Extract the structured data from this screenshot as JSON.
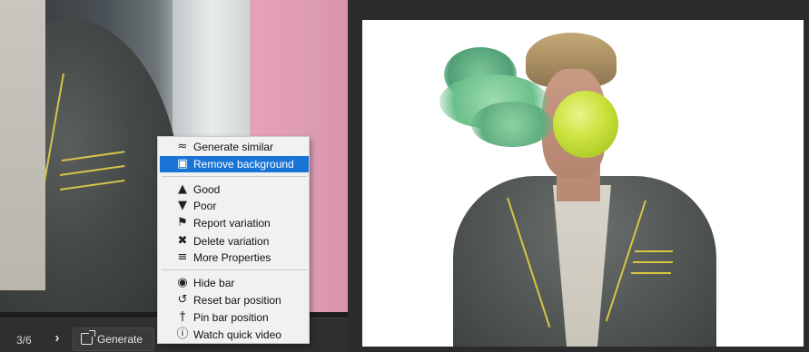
{
  "left_panel": {
    "counter": "3/6",
    "next_icon": "chevron-right-icon",
    "generate_label": "Generate",
    "generate_icon": "open-external-icon"
  },
  "context_menu": {
    "items": [
      {
        "label": "Generate similar",
        "icon": "approx-icon",
        "active": false
      },
      {
        "label": "Remove background",
        "icon": "image-icon",
        "active": true
      },
      {
        "label": "Good",
        "icon": "thumbs-up-icon",
        "active": false
      },
      {
        "label": "Poor",
        "icon": "thumbs-down-icon",
        "active": false
      },
      {
        "label": "Report variation",
        "icon": "flag-icon",
        "active": false
      },
      {
        "label": "Delete variation",
        "icon": "trash-icon",
        "active": false
      },
      {
        "label": "More Properties",
        "icon": "sliders-icon",
        "active": false
      },
      {
        "label": "Hide bar",
        "icon": "eye-off-icon",
        "active": false
      },
      {
        "label": "Reset bar position",
        "icon": "undo-icon",
        "active": false
      },
      {
        "label": "Pin bar position",
        "icon": "pin-icon",
        "active": false
      },
      {
        "label": "Watch quick video",
        "icon": "info-icon",
        "active": false
      }
    ]
  },
  "colors": {
    "menu_highlight": "#1a74d6",
    "background": "#2b2b2b"
  }
}
